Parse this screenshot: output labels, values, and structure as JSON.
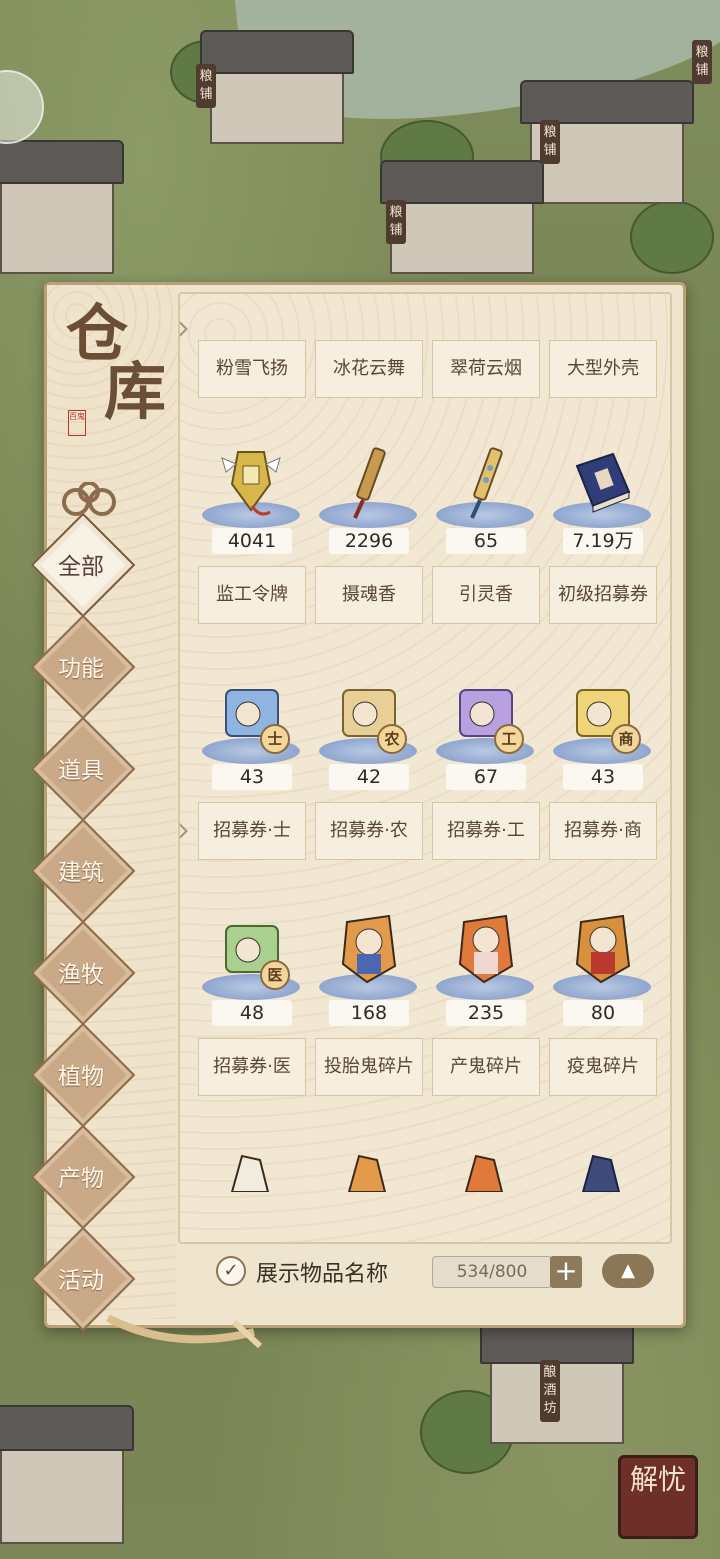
{
  "title": {
    "line1": "仓",
    "line2": "库",
    "badge": "百鬼"
  },
  "map_signs": [
    "粮铺",
    "粮铺",
    "粮铺",
    "粮铺",
    "酿酒坊"
  ],
  "corner_button": {
    "label": "解忧"
  },
  "tabs": [
    {
      "label": "全部",
      "active": true
    },
    {
      "label": "功能"
    },
    {
      "label": "道具"
    },
    {
      "label": "建筑"
    },
    {
      "label": "渔牧"
    },
    {
      "label": "植物"
    },
    {
      "label": "产物"
    },
    {
      "label": "活动"
    }
  ],
  "rows": [
    {
      "items": [
        {
          "name": "粉雪飞扬",
          "count": ""
        },
        {
          "name": "冰花云舞",
          "count": ""
        },
        {
          "name": "翠荷云烟",
          "count": ""
        },
        {
          "name": "大型外壳",
          "count": ""
        }
      ]
    },
    {
      "items": [
        {
          "name": "监工令牌",
          "count": "4041",
          "icon": "token-icon"
        },
        {
          "name": "摄魂香",
          "count": "2296",
          "icon": "incense-icon"
        },
        {
          "name": "引灵香",
          "count": "65",
          "icon": "incense-icon"
        },
        {
          "name": "初级招募券",
          "count": "7.19万",
          "icon": "book-icon"
        }
      ]
    },
    {
      "items": [
        {
          "name": "招募券·士",
          "count": "43",
          "icon": "scroll-icon",
          "badge": "士",
          "color": "#8fb4e0"
        },
        {
          "name": "招募券·农",
          "count": "42",
          "icon": "scroll-icon",
          "badge": "农",
          "color": "#e8cf95"
        },
        {
          "name": "招募券·工",
          "count": "67",
          "icon": "scroll-icon",
          "badge": "工",
          "color": "#b9a0e0"
        },
        {
          "name": "招募券·商",
          "count": "43",
          "icon": "scroll-icon",
          "badge": "商",
          "color": "#f0d47a"
        }
      ]
    },
    {
      "items": [
        {
          "name": "招募券·医",
          "count": "48",
          "icon": "scroll-icon",
          "badge": "医",
          "color": "#a9d08f"
        },
        {
          "name": "投胎鬼碎片",
          "count": "168",
          "icon": "ghost-fragment-icon",
          "color": "#e39a4a"
        },
        {
          "name": "产鬼碎片",
          "count": "235",
          "icon": "ghost-fragment-icon",
          "color": "#e07a3a"
        },
        {
          "name": "疫鬼碎片",
          "count": "80",
          "icon": "ghost-fragment-icon",
          "color": "#d8903c"
        }
      ]
    }
  ],
  "bottom": {
    "show_names_label": "展示物品名称",
    "show_names_checked": true,
    "capacity": "534/800",
    "plus": "+",
    "collapse": "▲"
  },
  "colors": {
    "panel": "#efe5cf",
    "tab": "#c9a987",
    "pedestal": "#8fa6cf"
  }
}
